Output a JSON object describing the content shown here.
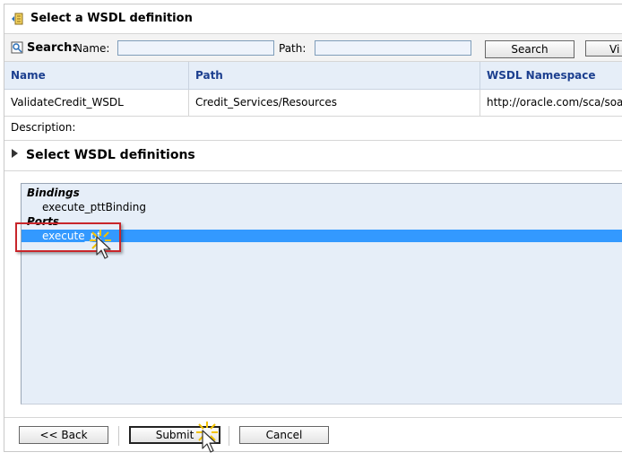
{
  "header": {
    "title": "Select a WSDL definition",
    "icon": "wsdl-icon"
  },
  "search": {
    "label": "Search:",
    "name_label": "Name:",
    "name_value": "",
    "path_label": "Path:",
    "path_value": "",
    "search_button": "Search",
    "view_button": "Vi"
  },
  "table": {
    "columns": [
      "Name",
      "Path",
      "WSDL Namespace"
    ],
    "rows": [
      [
        "ValidateCredit_WSDL",
        "Credit_Services/Resources",
        "http://oracle.com/sca/soapse"
      ]
    ]
  },
  "description": {
    "label": "Description:"
  },
  "section": {
    "title": "Select WSDL definitions"
  },
  "tree": {
    "groups": [
      {
        "label": "Bindings",
        "items": [
          "execute_pttBinding"
        ]
      },
      {
        "label": "Ports",
        "items": [
          "execute_pt"
        ]
      }
    ],
    "selected_item": "execute_pt"
  },
  "footer": {
    "back": "<< Back",
    "submit": "Submit",
    "cancel": "Cancel"
  },
  "colors": {
    "selection": "#3399ff",
    "header_text": "#1c3f8f",
    "panel_bg": "#e6eef8",
    "highlight": "#c8262b"
  }
}
